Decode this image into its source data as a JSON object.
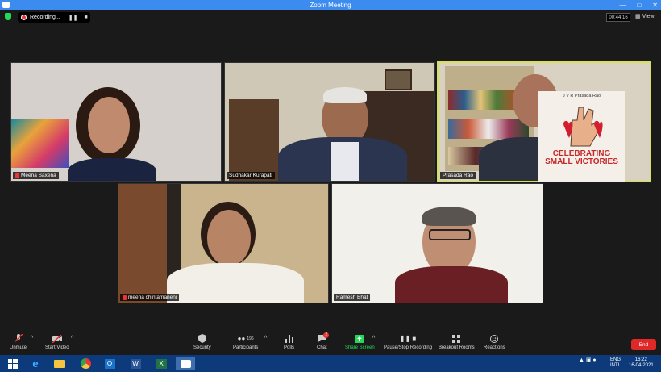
{
  "window": {
    "title": "Zoom Meeting"
  },
  "recording": {
    "label": "Recording...",
    "pause_icon": "pause-icon",
    "stop_icon": "stop-icon"
  },
  "timer": "00:44:16",
  "view_label": "View",
  "participants": [
    {
      "name": "Meena Saxena"
    },
    {
      "name": "Sudhakar Kurapati"
    },
    {
      "name": "Prasada Rao"
    },
    {
      "name": "meena chintamaneni"
    },
    {
      "name": "Ramesh Bhat"
    }
  ],
  "book": {
    "author": "J V R Prasada Rao",
    "title": "CELEBRATING SMALL VICTORIES"
  },
  "toolbar": {
    "unmute": "Unmute",
    "start_video": "Start Video",
    "security": "Security",
    "participants": "Participants",
    "participants_count": "196",
    "polls": "Polls",
    "chat": "Chat",
    "chat_badge": "2",
    "share_screen": "Share Screen",
    "pause_recording": "Pause/Stop Recording",
    "breakout_rooms": "Breakout Rooms",
    "reactions": "Reactions",
    "end": "End"
  },
  "taskbar": {
    "lang_top": "ENG",
    "lang_bottom": "INTL",
    "time": "16:22",
    "date": "16-04-2021"
  },
  "colors": {
    "active_speaker": "#d8e05a",
    "share_green": "#23d959",
    "end_red": "#e02828",
    "mute_red": "#e33"
  }
}
